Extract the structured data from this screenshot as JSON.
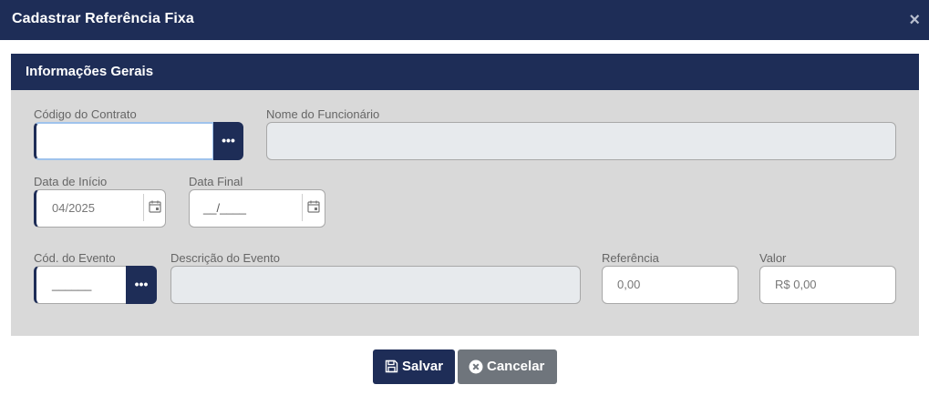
{
  "header": {
    "title": "Cadastrar Referência Fixa",
    "close_label": "×"
  },
  "panel": {
    "title": "Informações Gerais"
  },
  "fields": {
    "contract_code": {
      "label": "Código do Contrato",
      "value": "",
      "lookup_label": "•••"
    },
    "employee_name": {
      "label": "Nome do Funcionário",
      "value": ""
    },
    "start_date": {
      "label": "Data de Início",
      "value": "04/2025"
    },
    "end_date": {
      "label": "Data Final",
      "value": "__/____"
    },
    "event_code": {
      "label": "Cód. do Evento",
      "value": "______",
      "lookup_label": "•••"
    },
    "event_description": {
      "label": "Descrição do Evento",
      "value": ""
    },
    "reference": {
      "label": "Referência",
      "value": "0,00"
    },
    "amount": {
      "label": "Valor",
      "value": "R$ 0,00"
    }
  },
  "buttons": {
    "save_label": "Salvar",
    "cancel_label": "Cancelar"
  },
  "icons": {
    "close": "close-icon",
    "calendar": "calendar-icon",
    "save": "floppy-disk-icon",
    "cancel": "circle-x-icon"
  },
  "colors": {
    "primary": "#1e2d57",
    "panel_bg": "#d9d9d9",
    "cancel": "#6f757c",
    "focus": "#9fc3ec"
  }
}
